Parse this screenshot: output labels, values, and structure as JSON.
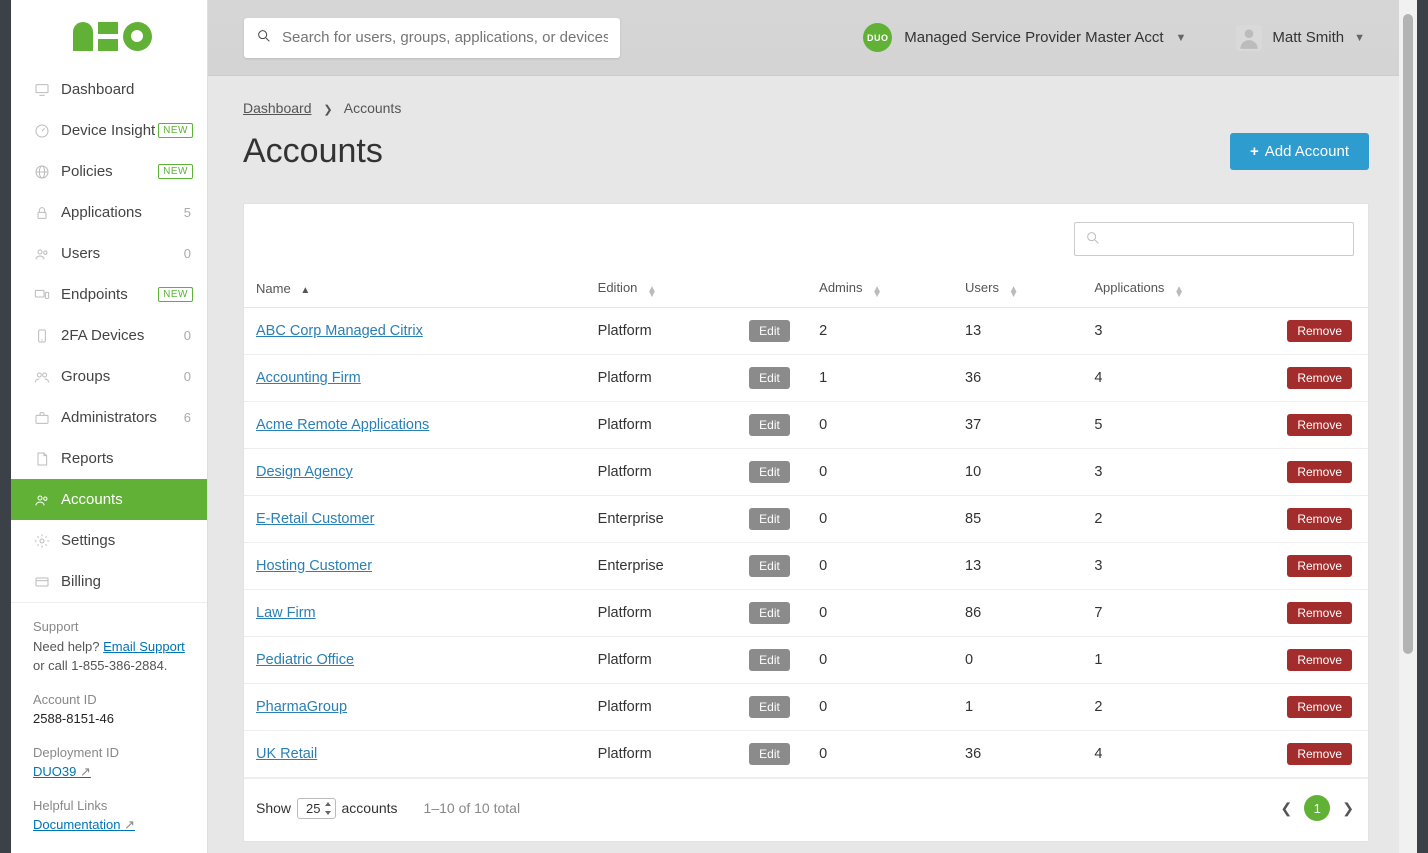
{
  "search": {
    "placeholder": "Search for users, groups, applications, or devices"
  },
  "header": {
    "account_name": "Managed Service Provider Master Acct",
    "account_badge": "DUO",
    "user_name": "Matt Smith"
  },
  "sidebar": {
    "items": [
      {
        "label": "Dashboard",
        "icon": "monitor",
        "count": "",
        "new": false,
        "active": false
      },
      {
        "label": "Device Insight",
        "icon": "gauge",
        "count": "",
        "new": true,
        "active": false
      },
      {
        "label": "Policies",
        "icon": "globe",
        "count": "",
        "new": true,
        "active": false
      },
      {
        "label": "Applications",
        "icon": "lock",
        "count": "5",
        "new": false,
        "active": false
      },
      {
        "label": "Users",
        "icon": "users",
        "count": "0",
        "new": false,
        "active": false
      },
      {
        "label": "Endpoints",
        "icon": "devices",
        "count": "",
        "new": true,
        "active": false
      },
      {
        "label": "2FA Devices",
        "icon": "phone",
        "count": "0",
        "new": false,
        "active": false
      },
      {
        "label": "Groups",
        "icon": "group",
        "count": "0",
        "new": false,
        "active": false
      },
      {
        "label": "Administrators",
        "icon": "briefcase",
        "count": "6",
        "new": false,
        "active": false
      },
      {
        "label": "Reports",
        "icon": "file",
        "count": "",
        "new": false,
        "active": false
      },
      {
        "label": "Accounts",
        "icon": "users",
        "count": "",
        "new": false,
        "active": true
      },
      {
        "label": "Settings",
        "icon": "gear",
        "count": "",
        "new": false,
        "active": false
      },
      {
        "label": "Billing",
        "icon": "card",
        "count": "",
        "new": false,
        "active": false
      }
    ]
  },
  "support": {
    "heading": "Support",
    "need_help": "Need help?",
    "email_link": "Email Support",
    "call_text": "or call 1-855-386-2884.",
    "account_id_label": "Account ID",
    "account_id": "2588-8151-46",
    "deployment_id_label": "Deployment ID",
    "deployment_id": "DUO39",
    "helpful_links": "Helpful Links",
    "doc_link": "Documentation"
  },
  "breadcrumb": {
    "root": "Dashboard",
    "current": "Accounts"
  },
  "page": {
    "title": "Accounts",
    "add_button": "Add Account"
  },
  "badges": {
    "new": "NEW"
  },
  "table": {
    "columns": {
      "name": "Name",
      "edition": "Edition",
      "admins": "Admins",
      "users": "Users",
      "applications": "Applications"
    },
    "edit_label": "Edit",
    "remove_label": "Remove",
    "rows": [
      {
        "name": "ABC Corp Managed Citrix",
        "edition": "Platform",
        "admins": "2",
        "users": "13",
        "applications": "3"
      },
      {
        "name": "Accounting Firm",
        "edition": "Platform",
        "admins": "1",
        "users": "36",
        "applications": "4"
      },
      {
        "name": "Acme Remote Applications",
        "edition": "Platform",
        "admins": "0",
        "users": "37",
        "applications": "5"
      },
      {
        "name": "Design Agency",
        "edition": "Platform",
        "admins": "0",
        "users": "10",
        "applications": "3"
      },
      {
        "name": "E-Retail Customer",
        "edition": "Enterprise",
        "admins": "0",
        "users": "85",
        "applications": "2"
      },
      {
        "name": "Hosting Customer",
        "edition": "Enterprise",
        "admins": "0",
        "users": "13",
        "applications": "3"
      },
      {
        "name": "Law Firm",
        "edition": "Platform",
        "admins": "0",
        "users": "86",
        "applications": "7"
      },
      {
        "name": "Pediatric Office",
        "edition": "Platform",
        "admins": "0",
        "users": "0",
        "applications": "1"
      },
      {
        "name": "PharmaGroup",
        "edition": "Platform",
        "admins": "0",
        "users": "1",
        "applications": "2"
      },
      {
        "name": "UK Retail",
        "edition": "Platform",
        "admins": "0",
        "users": "36",
        "applications": "4"
      }
    ]
  },
  "footer": {
    "show_label": "Show",
    "page_size": "25",
    "unit": "accounts",
    "range": "1–10 of 10 total",
    "current_page": "1"
  }
}
